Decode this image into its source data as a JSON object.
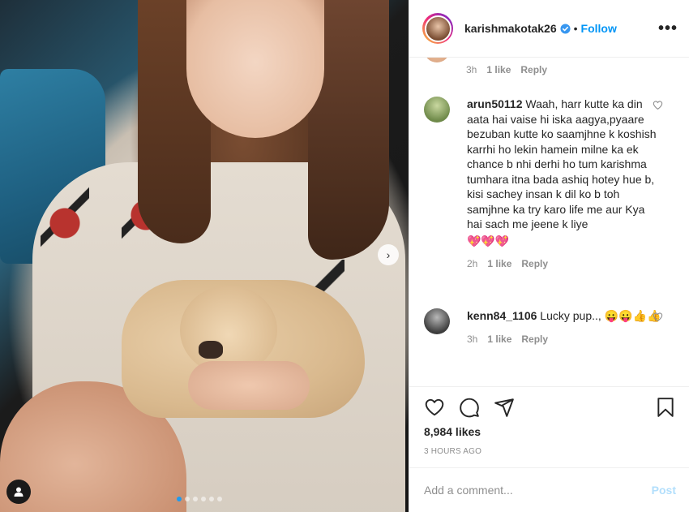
{
  "header": {
    "username": "karishmakotak26",
    "bullet": "•",
    "follow_label": "Follow",
    "more_label": "•••",
    "icons": {
      "verified": "verified-badge-icon",
      "more": "more-options-icon"
    }
  },
  "comments": {
    "previous_meta": {
      "time": "3h",
      "likes": "1 like",
      "reply": "Reply"
    },
    "items": [
      {
        "username": "arun50112",
        "text": "Waah, harr kutte ka din aata hai vaise hi iska aagya,pyaare bezuban kutte ko saamjhne k koshish karrhi ho lekin hamein milne ka ek chance b nhi derhi ho tum karishma tumhara itna bada ashiq hotey hue b, kisi sachey insan k dil ko b toh samjhne ka try karo life me aur Kya hai sach me jeene k liye",
        "emoji": "💖💖💖",
        "time": "2h",
        "likes": "1 like",
        "reply": "Reply"
      },
      {
        "username": "kenn84_1106",
        "text": "Lucky pup..,",
        "emoji": "😛😛👍👍",
        "time": "3h",
        "likes": "1 like",
        "reply": "Reply"
      }
    ]
  },
  "actions": {
    "icons": [
      "heart-icon",
      "comment-icon",
      "share-icon",
      "bookmark-icon"
    ],
    "likes": "8,984 likes",
    "time_ago": "3 HOURS AGO"
  },
  "add_comment": {
    "placeholder": "Add a comment...",
    "post_label": "Post"
  },
  "media": {
    "next_label": "›",
    "carousel_count": 6,
    "carousel_active": 0
  },
  "colors": {
    "accent": "#0095f6",
    "post_disabled": "#b2dffc",
    "muted": "#8e8e8e",
    "text": "#262626"
  }
}
